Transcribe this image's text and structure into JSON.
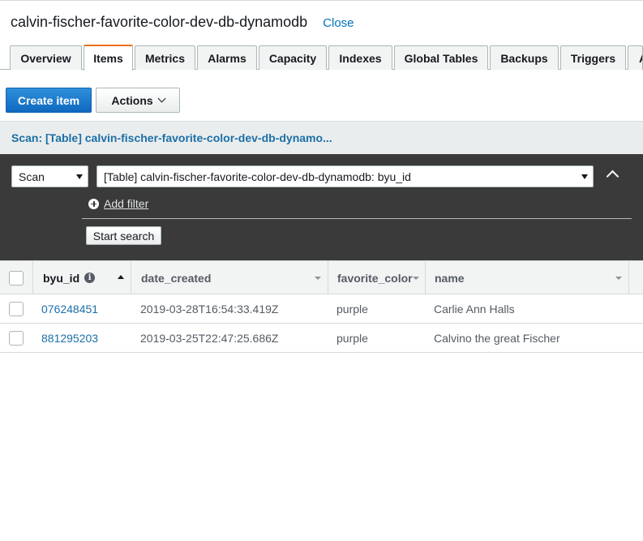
{
  "header": {
    "title": "calvin-fischer-favorite-color-dev-db-dynamodb",
    "close_label": "Close"
  },
  "tabs": [
    {
      "label": "Overview",
      "active": false
    },
    {
      "label": "Items",
      "active": true
    },
    {
      "label": "Metrics",
      "active": false
    },
    {
      "label": "Alarms",
      "active": false
    },
    {
      "label": "Capacity",
      "active": false
    },
    {
      "label": "Indexes",
      "active": false
    },
    {
      "label": "Global Tables",
      "active": false
    },
    {
      "label": "Backups",
      "active": false
    },
    {
      "label": "Triggers",
      "active": false
    },
    {
      "label": "A",
      "active": false
    }
  ],
  "toolbar": {
    "create_item_label": "Create item",
    "actions_label": "Actions"
  },
  "scan_panel": {
    "header": "Scan: [Table] calvin-fischer-favorite-color-dev-db-dynamo...",
    "mode_value": "Scan",
    "source_value": "[Table] calvin-fischer-favorite-color-dev-db-dynamodb: byu_id",
    "add_filter_label": "Add filter",
    "start_search_label": "Start search"
  },
  "table": {
    "columns": [
      "byu_id",
      "date_created",
      "favorite_color",
      "name"
    ],
    "rows": [
      {
        "byu_id": "076248451",
        "date_created": "2019-03-28T16:54:33.419Z",
        "favorite_color": "purple",
        "name": "Carlie Ann Halls"
      },
      {
        "byu_id": "881295203",
        "date_created": "2019-03-25T22:47:25.686Z",
        "favorite_color": "purple",
        "name": "Calvino the great Fischer"
      }
    ]
  },
  "colors": {
    "accent": "#ec7211",
    "primary_button": "#1a7bd0",
    "link": "#1b6fa8",
    "panel_dark": "#3a3a3a"
  }
}
